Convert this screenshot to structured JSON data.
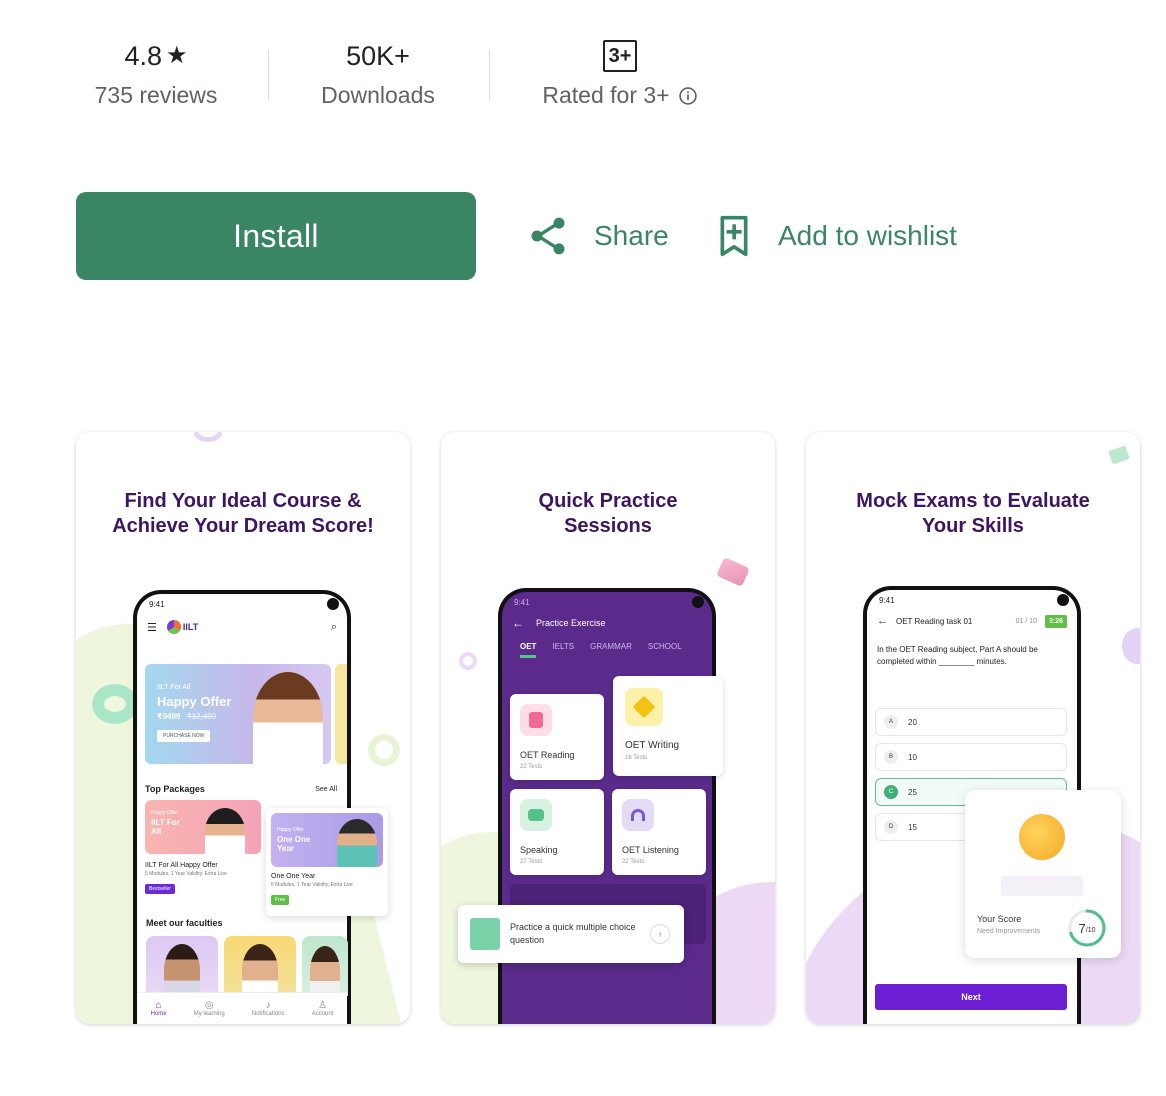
{
  "stats": {
    "rating": {
      "value": "4.8",
      "star": "★",
      "label": "735 reviews"
    },
    "downloads": {
      "value": "50K+",
      "label": "Downloads"
    },
    "content_rating": {
      "badge": "3+",
      "label": "Rated for 3+",
      "icon": "info-icon"
    }
  },
  "actions": {
    "install_label": "Install",
    "share_label": "Share",
    "wishlist_label": "Add to wishlist"
  },
  "colors": {
    "accent": "#3a8564",
    "title_purple": "#3d1561",
    "app_purple": "#5b2b8c",
    "button_purple": "#6c1fd2"
  },
  "screens": [
    {
      "title": "Find Your Ideal Course & Achieve Your Dream Score!",
      "time": "9:41",
      "logo": "IILT",
      "banner": {
        "small": "IILT For All",
        "headline": "Happy Offer",
        "price": "₹9499",
        "old_price": "₹12,499",
        "cta": "PURCHASE NOW"
      },
      "top_packages": "Top Packages",
      "see_all": "See All",
      "pkg1": {
        "tag": "Happy Offer",
        "title": "IILT For All",
        "name": "IILT For All Happy Offer",
        "desc": "5 Modules, 1 Year Validity, Extra Live",
        "badge": "Bestseller"
      },
      "pkg2": {
        "tag": "Happy Offer",
        "title": "One One Year",
        "name": "One One Year",
        "desc": "5 Modules, 1 Year Validity, Extra Live",
        "badge": "Free"
      },
      "faculties": "Meet our faculties",
      "nav": [
        "Home",
        "My learning",
        "Notifications",
        "Account"
      ]
    },
    {
      "title": "Quick Practice Sessions",
      "time": "9:41",
      "header": "Practice Exercise",
      "tabs": [
        "OET",
        "IELTS",
        "GRAMMAR",
        "SCHOOL"
      ],
      "tiles": [
        {
          "name": "OET Reading",
          "count": "22 Tests"
        },
        {
          "name": "OET Writing",
          "count": "16 Tests"
        },
        {
          "name": "Speaking",
          "count": "27 Tests"
        },
        {
          "name": "OET Listening",
          "count": "22 Tests"
        }
      ],
      "popup": "Practice a quick multiple choice question"
    },
    {
      "title": "Mock Exams to Evaluate Your Skills",
      "time": "9:41",
      "task": "OET Reading task 01",
      "progress": "01 / 10",
      "timer": "3:26",
      "question": "In the OET Reading subject, Part A should be completed within ________ minutes.",
      "options": [
        {
          "letter": "A",
          "value": "20"
        },
        {
          "letter": "B",
          "value": "10"
        },
        {
          "letter": "C",
          "value": "25"
        },
        {
          "letter": "D",
          "value": "15"
        }
      ],
      "score_label": "Your Score",
      "score_sub": "Need Improvements",
      "score": "7",
      "score_total": "/10",
      "score_fraction": 0.7,
      "next": "Next"
    }
  ]
}
